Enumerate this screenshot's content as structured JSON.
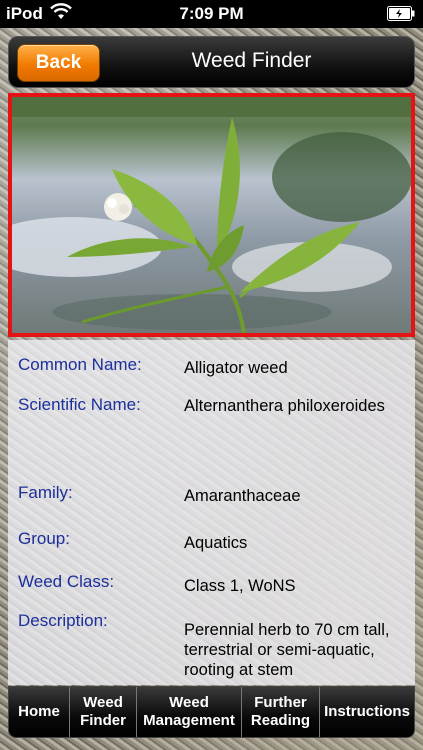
{
  "status_bar": {
    "carrier": "iPod",
    "time": "7:09 PM",
    "wifi_icon": "wifi-icon",
    "battery_icon": "battery-charging-icon"
  },
  "nav": {
    "back_label": "Back",
    "title": "Weed Finder"
  },
  "details": {
    "common_name_label": "Common Name:",
    "common_name_value": "Alligator weed",
    "scientific_name_label": "Scientific Name:",
    "scientific_name_value": "Alternanthera philoxeroides",
    "family_label": "Family:",
    "family_value": "Amaranthaceae",
    "group_label": "Group:",
    "group_value": "Aquatics",
    "weed_class_label": "Weed Class:",
    "weed_class_value": "Class 1, WoNS",
    "description_label": "Description:",
    "description_value": "Perennial herb to 70 cm tall, terrestrial or semi-aquatic, rooting at stem"
  },
  "tabs": {
    "home": "Home",
    "weed_finder_1": "Weed",
    "weed_finder_2": "Finder",
    "weed_management_1": "Weed",
    "weed_management_2": "Management",
    "further_reading_1": "Further",
    "further_reading_2": "Reading",
    "instructions": "Instructions"
  },
  "colors": {
    "accent_orange": "#f27a00",
    "label_blue": "#1c2f9a",
    "photo_border_red": "#e41414"
  }
}
